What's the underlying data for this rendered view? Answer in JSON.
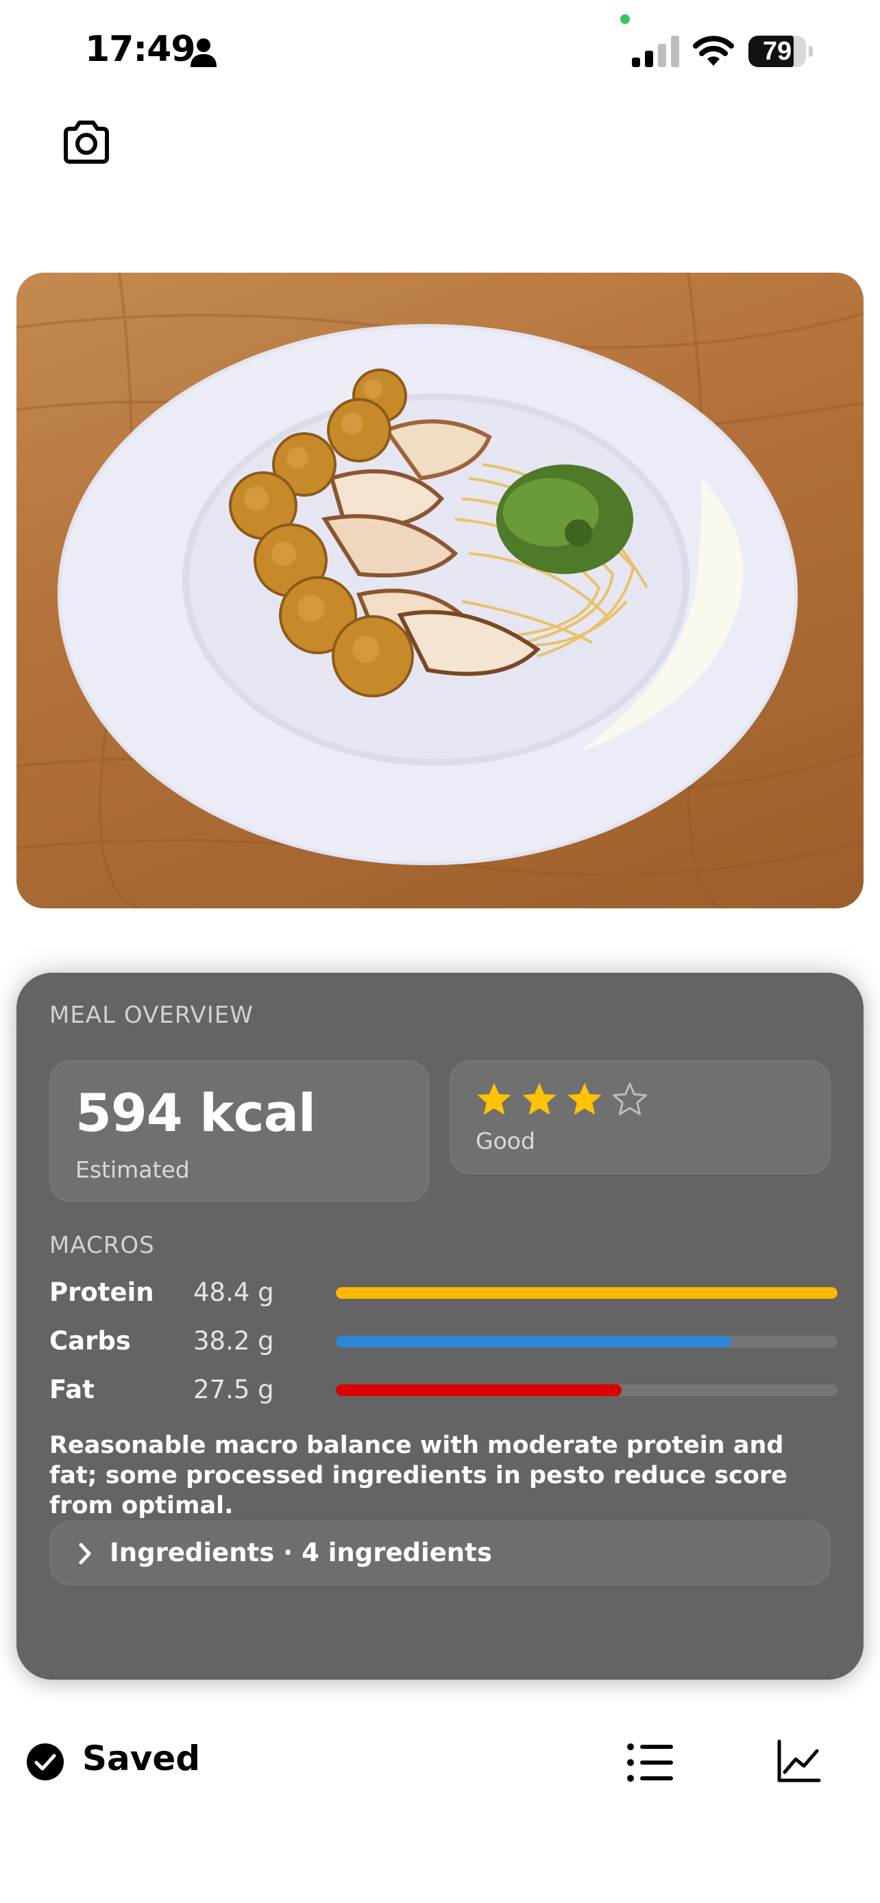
{
  "status_bar": {
    "time": "17:49",
    "battery_level": "79",
    "battery_fraction": 0.79
  },
  "header": {
    "camera_icon": "camera-icon"
  },
  "meal_photo": {
    "icon": "meal-photo"
  },
  "overview": {
    "section_label": "MEAL OVERVIEW",
    "kcal_value": "594 kcal",
    "kcal_caption": "Estimated",
    "rating": {
      "stars_filled": 3,
      "stars_total": 4,
      "label": "Good",
      "star_color": "#ffc300"
    },
    "macros_label": "MACROS",
    "macros": [
      {
        "name": "Protein",
        "value": "48.4 g",
        "fill": 1.0,
        "color": "#ffb800"
      },
      {
        "name": "Carbs",
        "value": "38.2 g",
        "fill": 0.79,
        "color": "#2f86d6"
      },
      {
        "name": "Fat",
        "value": "27.5 g",
        "fill": 0.57,
        "color": "#dd0000"
      }
    ],
    "summary": "Reasonable macro balance with moderate protein and fat; some processed ingredients in pesto reduce score from optimal.",
    "ingredients_button": "Ingredients · 4 ingredients"
  },
  "bottom_bar": {
    "saved_label": "Saved",
    "icons": [
      "checkmark-circle-icon",
      "list-icon",
      "chart-icon"
    ]
  },
  "colors": {
    "card_background": "#646464",
    "background": "#ffffff"
  }
}
